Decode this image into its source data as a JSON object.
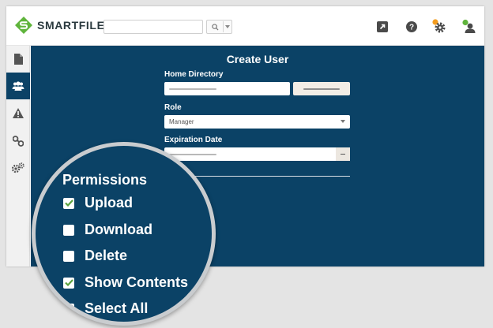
{
  "app": {
    "brand": "SMARTFILE"
  },
  "search": {
    "placeholder": ""
  },
  "form": {
    "title": "Create User",
    "home_directory_label": "Home Directory",
    "role_label": "Role",
    "role_value": "Manager",
    "expiration_label": "Expiration Date"
  },
  "behind": [
    "ons",
    "d",
    "ntents"
  ],
  "permissions": {
    "title": "Permissions",
    "items": [
      {
        "label": "Upload",
        "checked": true
      },
      {
        "label": "Download",
        "checked": false
      },
      {
        "label": "Delete",
        "checked": false
      },
      {
        "label": "Show Contents",
        "checked": true
      },
      {
        "label": "Select All",
        "checked": false
      }
    ]
  },
  "colors": {
    "brand_green": "#5fb43b",
    "navy": "#0b4266",
    "check_green": "#5ba33f",
    "settings_badge": "#f39c1f"
  },
  "icons": {
    "sidebar": [
      "file-icon",
      "users-icon",
      "warning-icon",
      "link-icon",
      "gears-icon"
    ],
    "top": [
      "external-link-icon",
      "help-icon",
      "settings-icon",
      "user-icon"
    ]
  }
}
